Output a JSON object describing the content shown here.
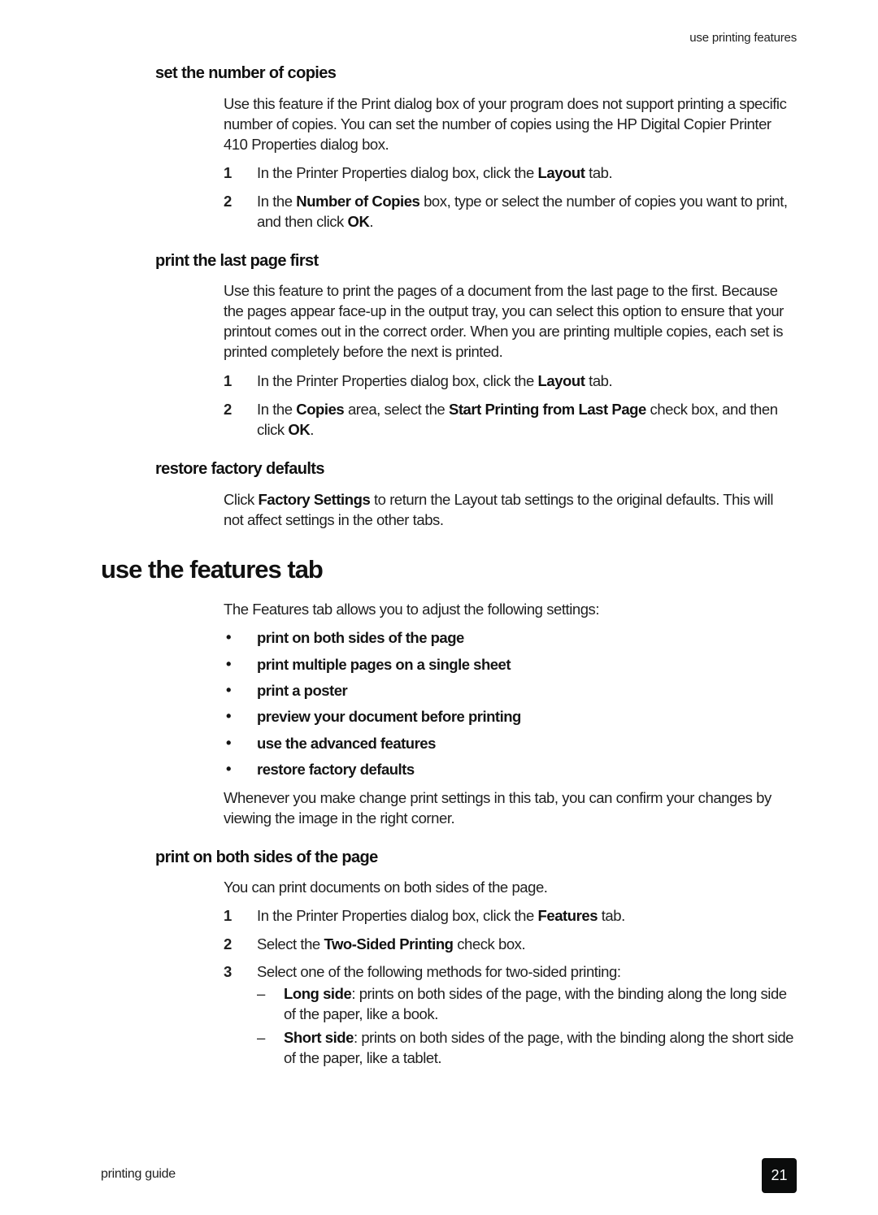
{
  "header": {
    "running_head": "use printing features"
  },
  "sections": {
    "copies": {
      "title": "set the number of copies",
      "intro": "Use this feature if the Print dialog box of your program does not support printing a specific number of copies. You can set the number of copies using the HP Digital Copier Printer 410 Properties dialog box.",
      "steps": [
        {
          "num": "1",
          "parts": [
            "In the Printer Properties dialog box, click the ",
            "Layout",
            " tab."
          ]
        },
        {
          "num": "2",
          "parts": [
            "In the ",
            "Number of Copies",
            " box, type or select the number of copies you want to print, and then click ",
            "OK",
            "."
          ]
        }
      ]
    },
    "last_page": {
      "title": "print the last page first",
      "intro": "Use this feature to print the pages of a document from the last page to the first. Because the pages appear face-up in the output tray, you can select this option to ensure that your printout comes out in the correct order. When you are printing multiple copies, each set is printed completely before the next is printed.",
      "steps": [
        {
          "num": "1",
          "parts": [
            "In the Printer Properties dialog box, click the ",
            "Layout",
            " tab."
          ]
        },
        {
          "num": "2",
          "parts": [
            "In the ",
            "Copies",
            " area, select the ",
            "Start Printing from Last Page",
            " check box, and then click ",
            "OK",
            "."
          ]
        }
      ]
    },
    "restore": {
      "title": "restore factory defaults",
      "parts": [
        "Click ",
        "Factory Settings",
        " to return the Layout tab settings to the original defaults. This will not affect settings in the other tabs."
      ]
    },
    "features_tab": {
      "title": "use the features tab",
      "intro": "The Features tab allows you to adjust the following settings:",
      "bullets": [
        "print on both sides of the page",
        "print multiple pages on a single sheet",
        "print a poster",
        "preview your document before printing",
        "use the advanced features",
        "restore factory defaults"
      ],
      "note": "Whenever you make change print settings in this tab, you can confirm your changes by viewing the image in the right corner."
    },
    "both_sides": {
      "title": "print on both sides of the page",
      "intro": "You can print documents on both sides of the page.",
      "steps": [
        {
          "num": "1",
          "parts": [
            "In the Printer Properties dialog box, click the ",
            "Features",
            " tab."
          ]
        },
        {
          "num": "2",
          "parts": [
            "Select the ",
            "Two-Sided Printing",
            " check box."
          ]
        },
        {
          "num": "3",
          "parts": [
            "Select one of the following methods for two-sided printing:"
          ]
        }
      ],
      "options": [
        {
          "dash": "–",
          "parts": [
            "Long side",
            ": prints on both sides of the page, with the binding along the long side of the paper, like a book."
          ]
        },
        {
          "dash": "–",
          "parts": [
            "Short side",
            ": prints on both sides of the page, with the binding along the short side of the paper, like a tablet."
          ]
        }
      ]
    }
  },
  "footer": {
    "guide_name": "printing guide",
    "page_number": "21"
  }
}
